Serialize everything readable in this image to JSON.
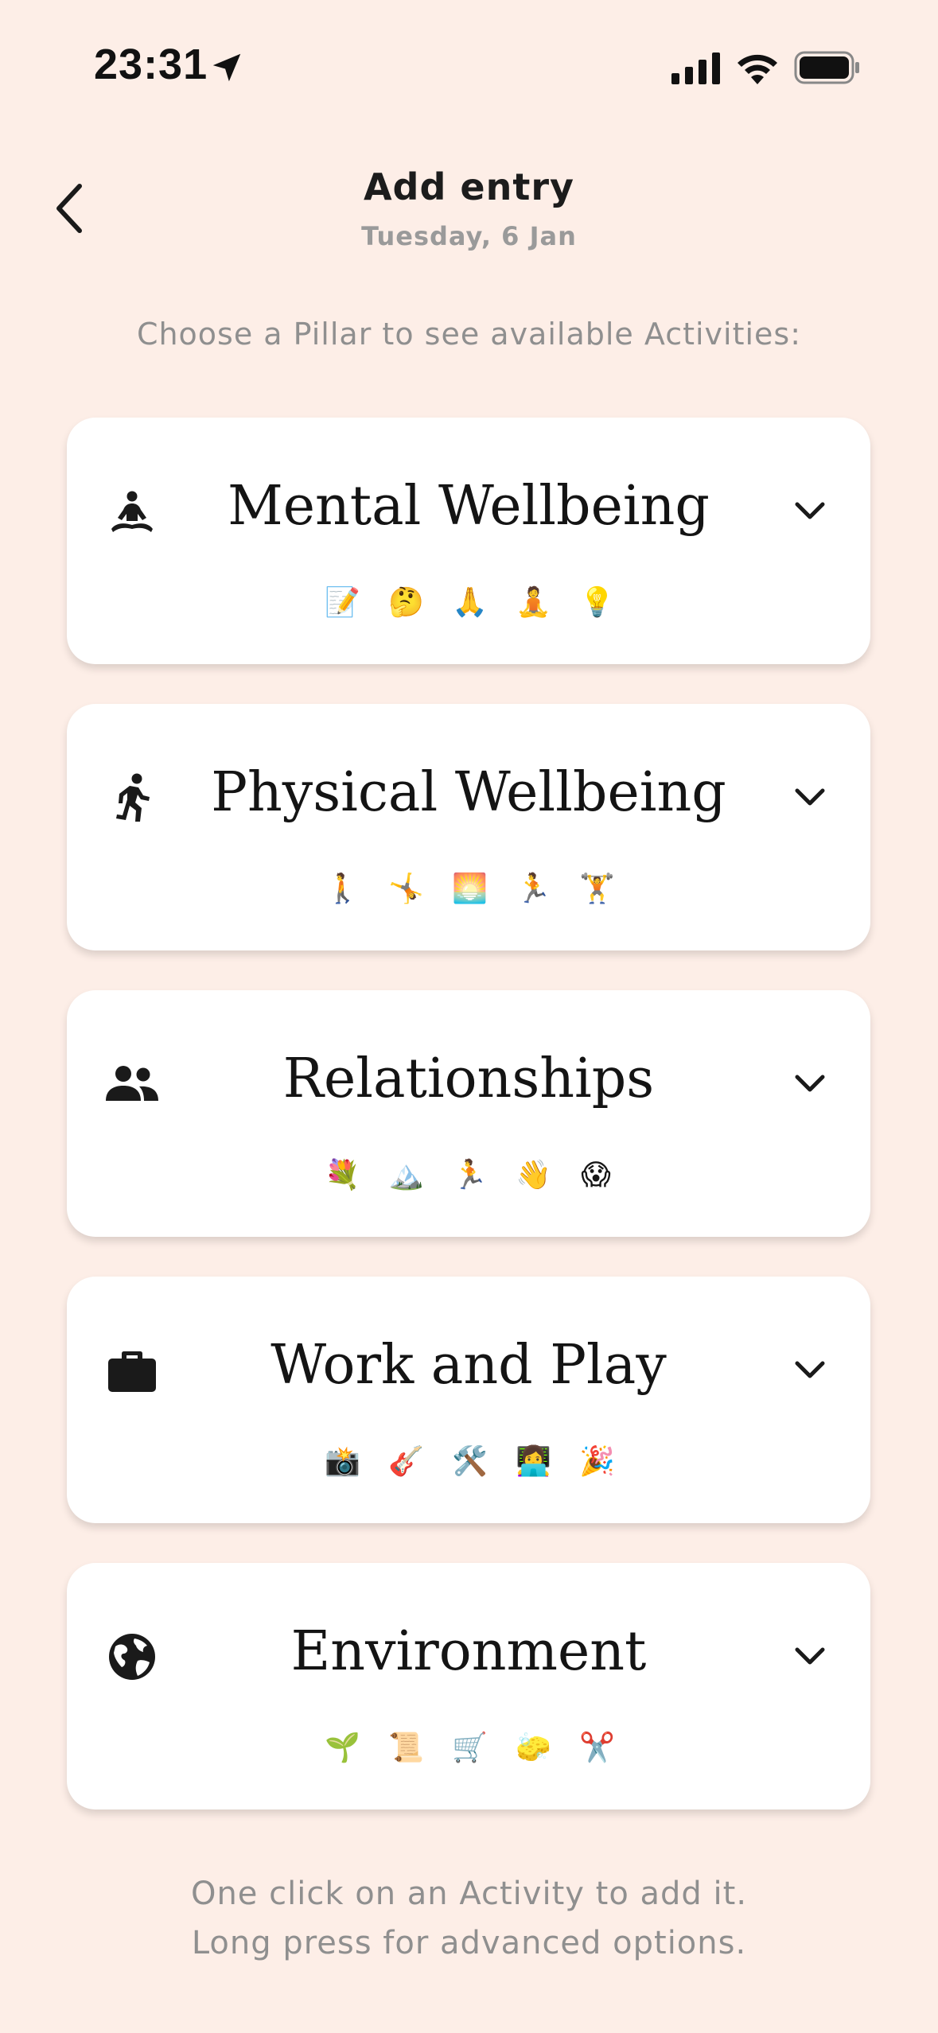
{
  "status_bar": {
    "time": "23:31",
    "icons": [
      "location-arrow-icon",
      "cellular-signal-icon",
      "wifi-icon",
      "battery-icon"
    ]
  },
  "header": {
    "title": "Add entry",
    "subtitle": "Tuesday, 6 Jan",
    "back_icon": "chevron-left-icon"
  },
  "instruction": "Choose a Pillar to see available Activities:",
  "pillars": [
    {
      "name": "Mental Wellbeing",
      "icon": "meditation-icon",
      "activities": [
        "📝",
        "🤔",
        "🙏",
        "🧘",
        "💡"
      ]
    },
    {
      "name": "Physical Wellbeing",
      "icon": "running-icon",
      "activities": [
        "🚶",
        "🤸",
        "🌅",
        "🏃",
        "🏋️"
      ]
    },
    {
      "name": "Relationships",
      "icon": "people-icon",
      "activities": [
        "💐",
        "🏔️",
        "🏃",
        "👋",
        "😱"
      ]
    },
    {
      "name": "Work and Play",
      "icon": "briefcase-icon",
      "activities": [
        "📸",
        "🎸",
        "🛠️",
        "👩‍💻",
        "🎉"
      ]
    },
    {
      "name": "Environment",
      "icon": "globe-icon",
      "activities": [
        "🌱",
        "📜",
        "🛒",
        "🧽",
        "✂️"
      ]
    }
  ],
  "footer": {
    "line1": "One click on an Activity to add it.",
    "line2": "Long press for advanced options."
  },
  "colors": {
    "background": "#fdeee7",
    "card": "#ffffff",
    "text_primary": "#141414",
    "text_secondary": "#8f8f8f"
  }
}
